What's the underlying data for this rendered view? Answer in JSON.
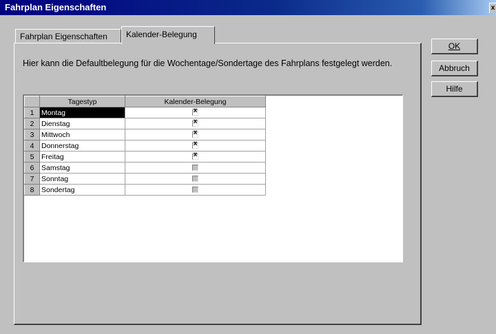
{
  "window": {
    "title": "Fahrplan Eigenschaften",
    "close_glyph": "x"
  },
  "tabs": [
    {
      "label": "Fahrplan Eigenschaften",
      "active": false
    },
    {
      "label": "Kalender-Belegung",
      "active": true
    }
  ],
  "panel": {
    "description": "Hier kann die Defaultbelegung für die Wochentage/Sondertage des Fahrplans festgelegt werden."
  },
  "grid": {
    "headers": {
      "rownum": "",
      "day": "Tagestyp",
      "check": "Kalender-Belegung"
    },
    "rows": [
      {
        "num": "1",
        "day": "Montag",
        "checked": true,
        "selected": true
      },
      {
        "num": "2",
        "day": "Dienstag",
        "checked": true,
        "selected": false
      },
      {
        "num": "3",
        "day": "Mittwoch",
        "checked": true,
        "selected": false
      },
      {
        "num": "4",
        "day": "Donnerstag",
        "checked": true,
        "selected": false
      },
      {
        "num": "5",
        "day": "Freitag",
        "checked": true,
        "selected": false
      },
      {
        "num": "6",
        "day": "Samstag",
        "checked": false,
        "selected": false
      },
      {
        "num": "7",
        "day": "Sonntag",
        "checked": false,
        "selected": false
      },
      {
        "num": "8",
        "day": "Sondertag",
        "checked": false,
        "selected": false
      }
    ],
    "check_glyph": "x"
  },
  "buttons": {
    "ok": "OK",
    "abbruch": "Abbruch",
    "hilfe": "Hilfe"
  },
  "colors": {
    "titlebar_start": "#000080",
    "titlebar_end": "#a6caf0",
    "face": "#c0c0c0",
    "selection": "#000000"
  },
  "icons": {
    "close": "close-icon",
    "checkbox_checked": "checkbox-checked-icon",
    "checkbox_unchecked": "checkbox-unchecked-icon"
  }
}
